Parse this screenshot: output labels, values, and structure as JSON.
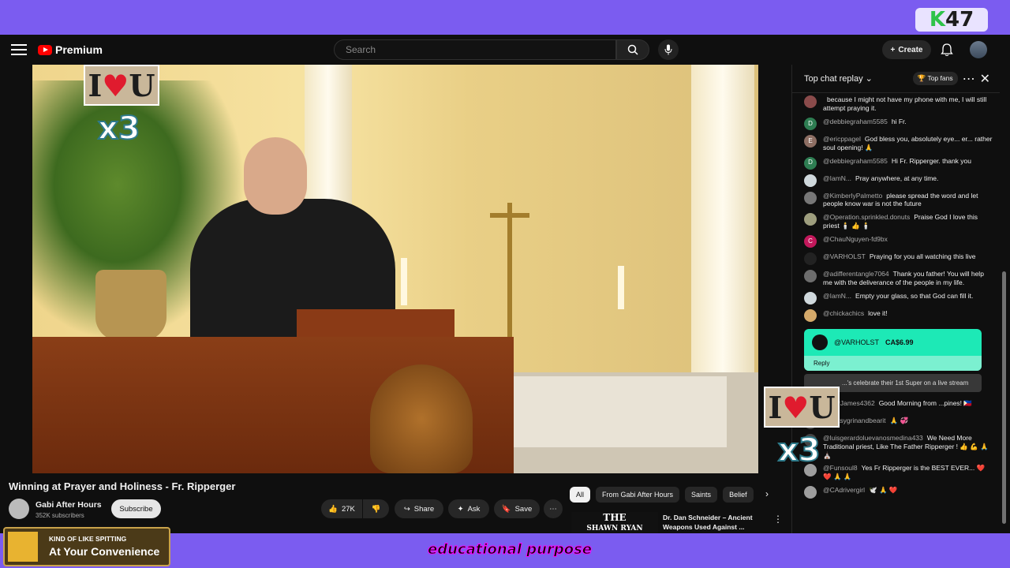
{
  "overlay": {
    "stream_badge_k": "K",
    "stream_badge_num": "47",
    "sticker_text_i": "I",
    "sticker_text_heart": "♥",
    "sticker_text_u": "U",
    "sticker_multiplier": "x3",
    "now_playing_sub": "KIND OF LIKE SPITTING",
    "now_playing_title": "At Your Convenience",
    "caption": "educational purpose"
  },
  "header": {
    "brand": "Premium",
    "search_placeholder": "Search",
    "create_label": "Create"
  },
  "video": {
    "title": "Winning at Prayer and Holiness - Fr. Ripperger",
    "channel": "Gabi After Hours",
    "subscribers": "352K subscribers",
    "subscribe_label": "Subscribe",
    "likes": "27K",
    "share_label": "Share",
    "ask_label": "Ask",
    "save_label": "Save"
  },
  "chips": [
    "All",
    "From Gabi After Hours",
    "Saints",
    "Belief"
  ],
  "recommended": {
    "thumb_line1": "THE",
    "thumb_line2": "SHAWN RYAN",
    "title": "Dr. Dan Schneider – Ancient Weapons Used Against ..."
  },
  "chat": {
    "title": "Top chat replay",
    "top_fans": "Top fans",
    "messages": [
      {
        "initial": "",
        "color": "#8a4b4b",
        "author": "",
        "text": "because I might not have my phone with me, I will still attempt praying it."
      },
      {
        "initial": "D",
        "color": "#2e7d52",
        "author": "@debbiegraham5585",
        "text": "hi Fr."
      },
      {
        "initial": "E",
        "color": "#8d6e63",
        "author": "@ericppagel",
        "text": "God bless you, absolutely eye... er... rather soul opening! 🙏"
      },
      {
        "initial": "D",
        "color": "#2e7d52",
        "author": "@debbiegraham5585",
        "text": "Hi Fr. Ripperger. thank you"
      },
      {
        "initial": "",
        "color": "#cfd8dc",
        "author": "@IamN...",
        "text": "Pray anywhere, at any time."
      },
      {
        "initial": "",
        "color": "#777777",
        "author": "@KimberlyPalmetto",
        "text": "please spread the word and let people know war is not the future"
      },
      {
        "initial": "",
        "color": "#9e9e7e",
        "author": "@Operation.sprinkled.donuts",
        "text": "Praise God I love this priest 🕯️ 👍 🕯️"
      },
      {
        "initial": "C",
        "color": "#c2185b",
        "author": "@ChauNguyen-fd9bx",
        "text": ""
      },
      {
        "initial": "",
        "color": "#222222",
        "author": "@VARHOLST",
        "text": "Praying for you all watching this live"
      },
      {
        "initial": "",
        "color": "#6d6d6d",
        "author": "@adifferentangle7064",
        "text": "Thank you father! You will help me with the deliverance of the people in my life."
      },
      {
        "initial": "",
        "color": "#cfd8dc",
        "author": "@IamN...",
        "text": "Empty your glass, so that God can fill it."
      },
      {
        "initial": "",
        "color": "#d4a96a",
        "author": "@chickachics",
        "text": "love it!"
      }
    ],
    "super_chat": {
      "author": "@VARHOLST",
      "amount": "CA$6.99",
      "reply": "Reply"
    },
    "celebrate": "...'s celebrate their 1st Super on a live stream",
    "messages_after": [
      {
        "initial": "",
        "color": "#555555",
        "author": "...therJames4362",
        "text": "Good Morning from ...pines! 🇵🇭"
      },
      {
        "initial": "",
        "color": "#444444",
        "author": "@Betsygrinandbearit",
        "text": "🙏 💞"
      },
      {
        "initial": "",
        "color": "#444444",
        "author": "@luisgerardoluevanosmedina433",
        "text": "We Need More Traditional priest, Like The Father Ripperger ! 👍 💪 🙏 ⛪"
      },
      {
        "initial": "",
        "color": "#9e9e9e",
        "author": "@Funsoul8",
        "text": "Yes Fr Ripperger is the BEST EVER... ❤️ ❤️ 🙏 🙏"
      },
      {
        "initial": "",
        "color": "#9e9e9e",
        "author": "@CAdrivergirl",
        "text": "🕊️ 🙏 ❤️"
      }
    ]
  }
}
